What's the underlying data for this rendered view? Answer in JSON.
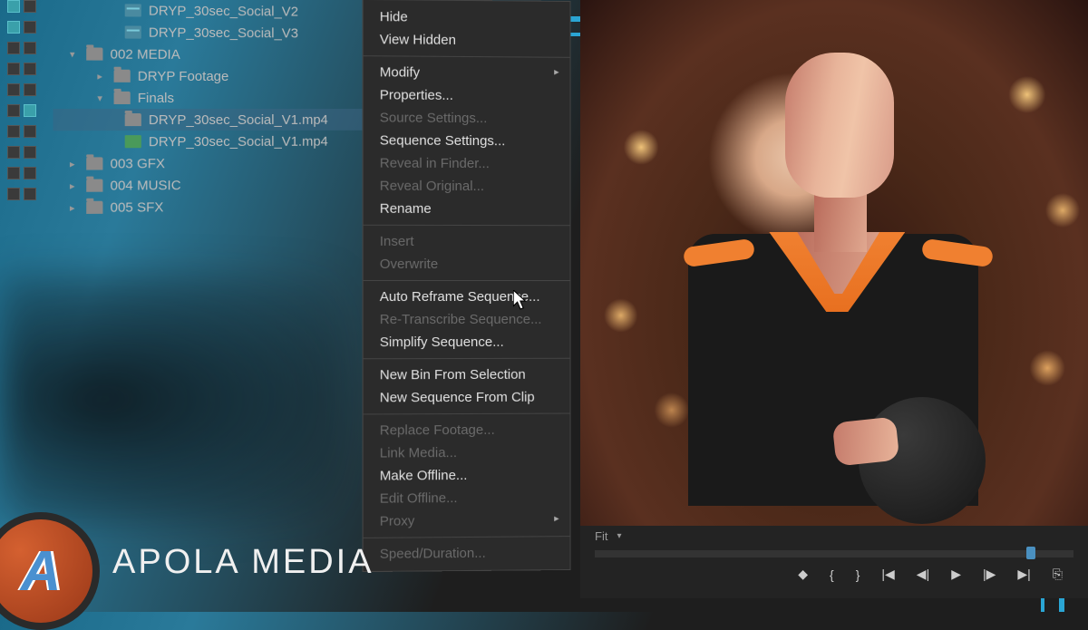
{
  "project_panel": {
    "items": [
      {
        "label": "DRYP_30sec_Social_V2",
        "type": "sequence",
        "indent": 3,
        "color": "cyan"
      },
      {
        "label": "DRYP_30sec_Social_V3",
        "type": "sequence",
        "indent": 3,
        "color": "cyan"
      },
      {
        "label": "002 MEDIA",
        "type": "folder",
        "indent": 1,
        "expanded": true
      },
      {
        "label": "DRYP Footage",
        "type": "folder",
        "indent": 2,
        "expanded": false
      },
      {
        "label": "Finals",
        "type": "folder",
        "indent": 2,
        "expanded": true
      },
      {
        "label": "DRYP_30sec_Social_V1.mp4",
        "type": "folder-item",
        "indent": 3,
        "selected": true
      },
      {
        "label": "DRYP_30sec_Social_V1.mp4",
        "type": "green",
        "indent": 3
      },
      {
        "label": "003 GFX",
        "type": "folder",
        "indent": 1,
        "expanded": false
      },
      {
        "label": "004 MUSIC",
        "type": "folder",
        "indent": 1,
        "expanded": false
      },
      {
        "label": "005 SFX",
        "type": "folder",
        "indent": 1,
        "expanded": false
      }
    ]
  },
  "context_menu": {
    "items": [
      {
        "label": "Hide",
        "enabled": true
      },
      {
        "label": "View Hidden",
        "enabled": true
      },
      {
        "sep": true
      },
      {
        "label": "Modify",
        "enabled": true,
        "submenu": true
      },
      {
        "label": "Properties...",
        "enabled": true
      },
      {
        "label": "Source Settings...",
        "enabled": false
      },
      {
        "label": "Sequence Settings...",
        "enabled": true
      },
      {
        "label": "Reveal in Finder...",
        "enabled": false
      },
      {
        "label": "Reveal Original...",
        "enabled": false
      },
      {
        "label": "Rename",
        "enabled": true
      },
      {
        "sep": true
      },
      {
        "label": "Insert",
        "enabled": false
      },
      {
        "label": "Overwrite",
        "enabled": false
      },
      {
        "sep": true
      },
      {
        "label": "Auto Reframe Sequence...",
        "enabled": true
      },
      {
        "label": "Re-Transcribe Sequence...",
        "enabled": false
      },
      {
        "label": "Simplify Sequence...",
        "enabled": true
      },
      {
        "sep": true
      },
      {
        "label": "New Bin From Selection",
        "enabled": true
      },
      {
        "label": "New Sequence From Clip",
        "enabled": true
      },
      {
        "sep": true
      },
      {
        "label": "Replace Footage...",
        "enabled": false
      },
      {
        "label": "Link Media...",
        "enabled": false
      },
      {
        "label": "Make Offline...",
        "enabled": true
      },
      {
        "label": "Edit Offline...",
        "enabled": false
      },
      {
        "label": "Proxy",
        "enabled": false,
        "submenu": true
      },
      {
        "sep": true
      },
      {
        "label": "Speed/Duration...",
        "enabled": false
      }
    ]
  },
  "preview": {
    "fit_label": "Fit"
  },
  "logo": {
    "monogram": "A",
    "brand": "APOLA MEDIA"
  }
}
